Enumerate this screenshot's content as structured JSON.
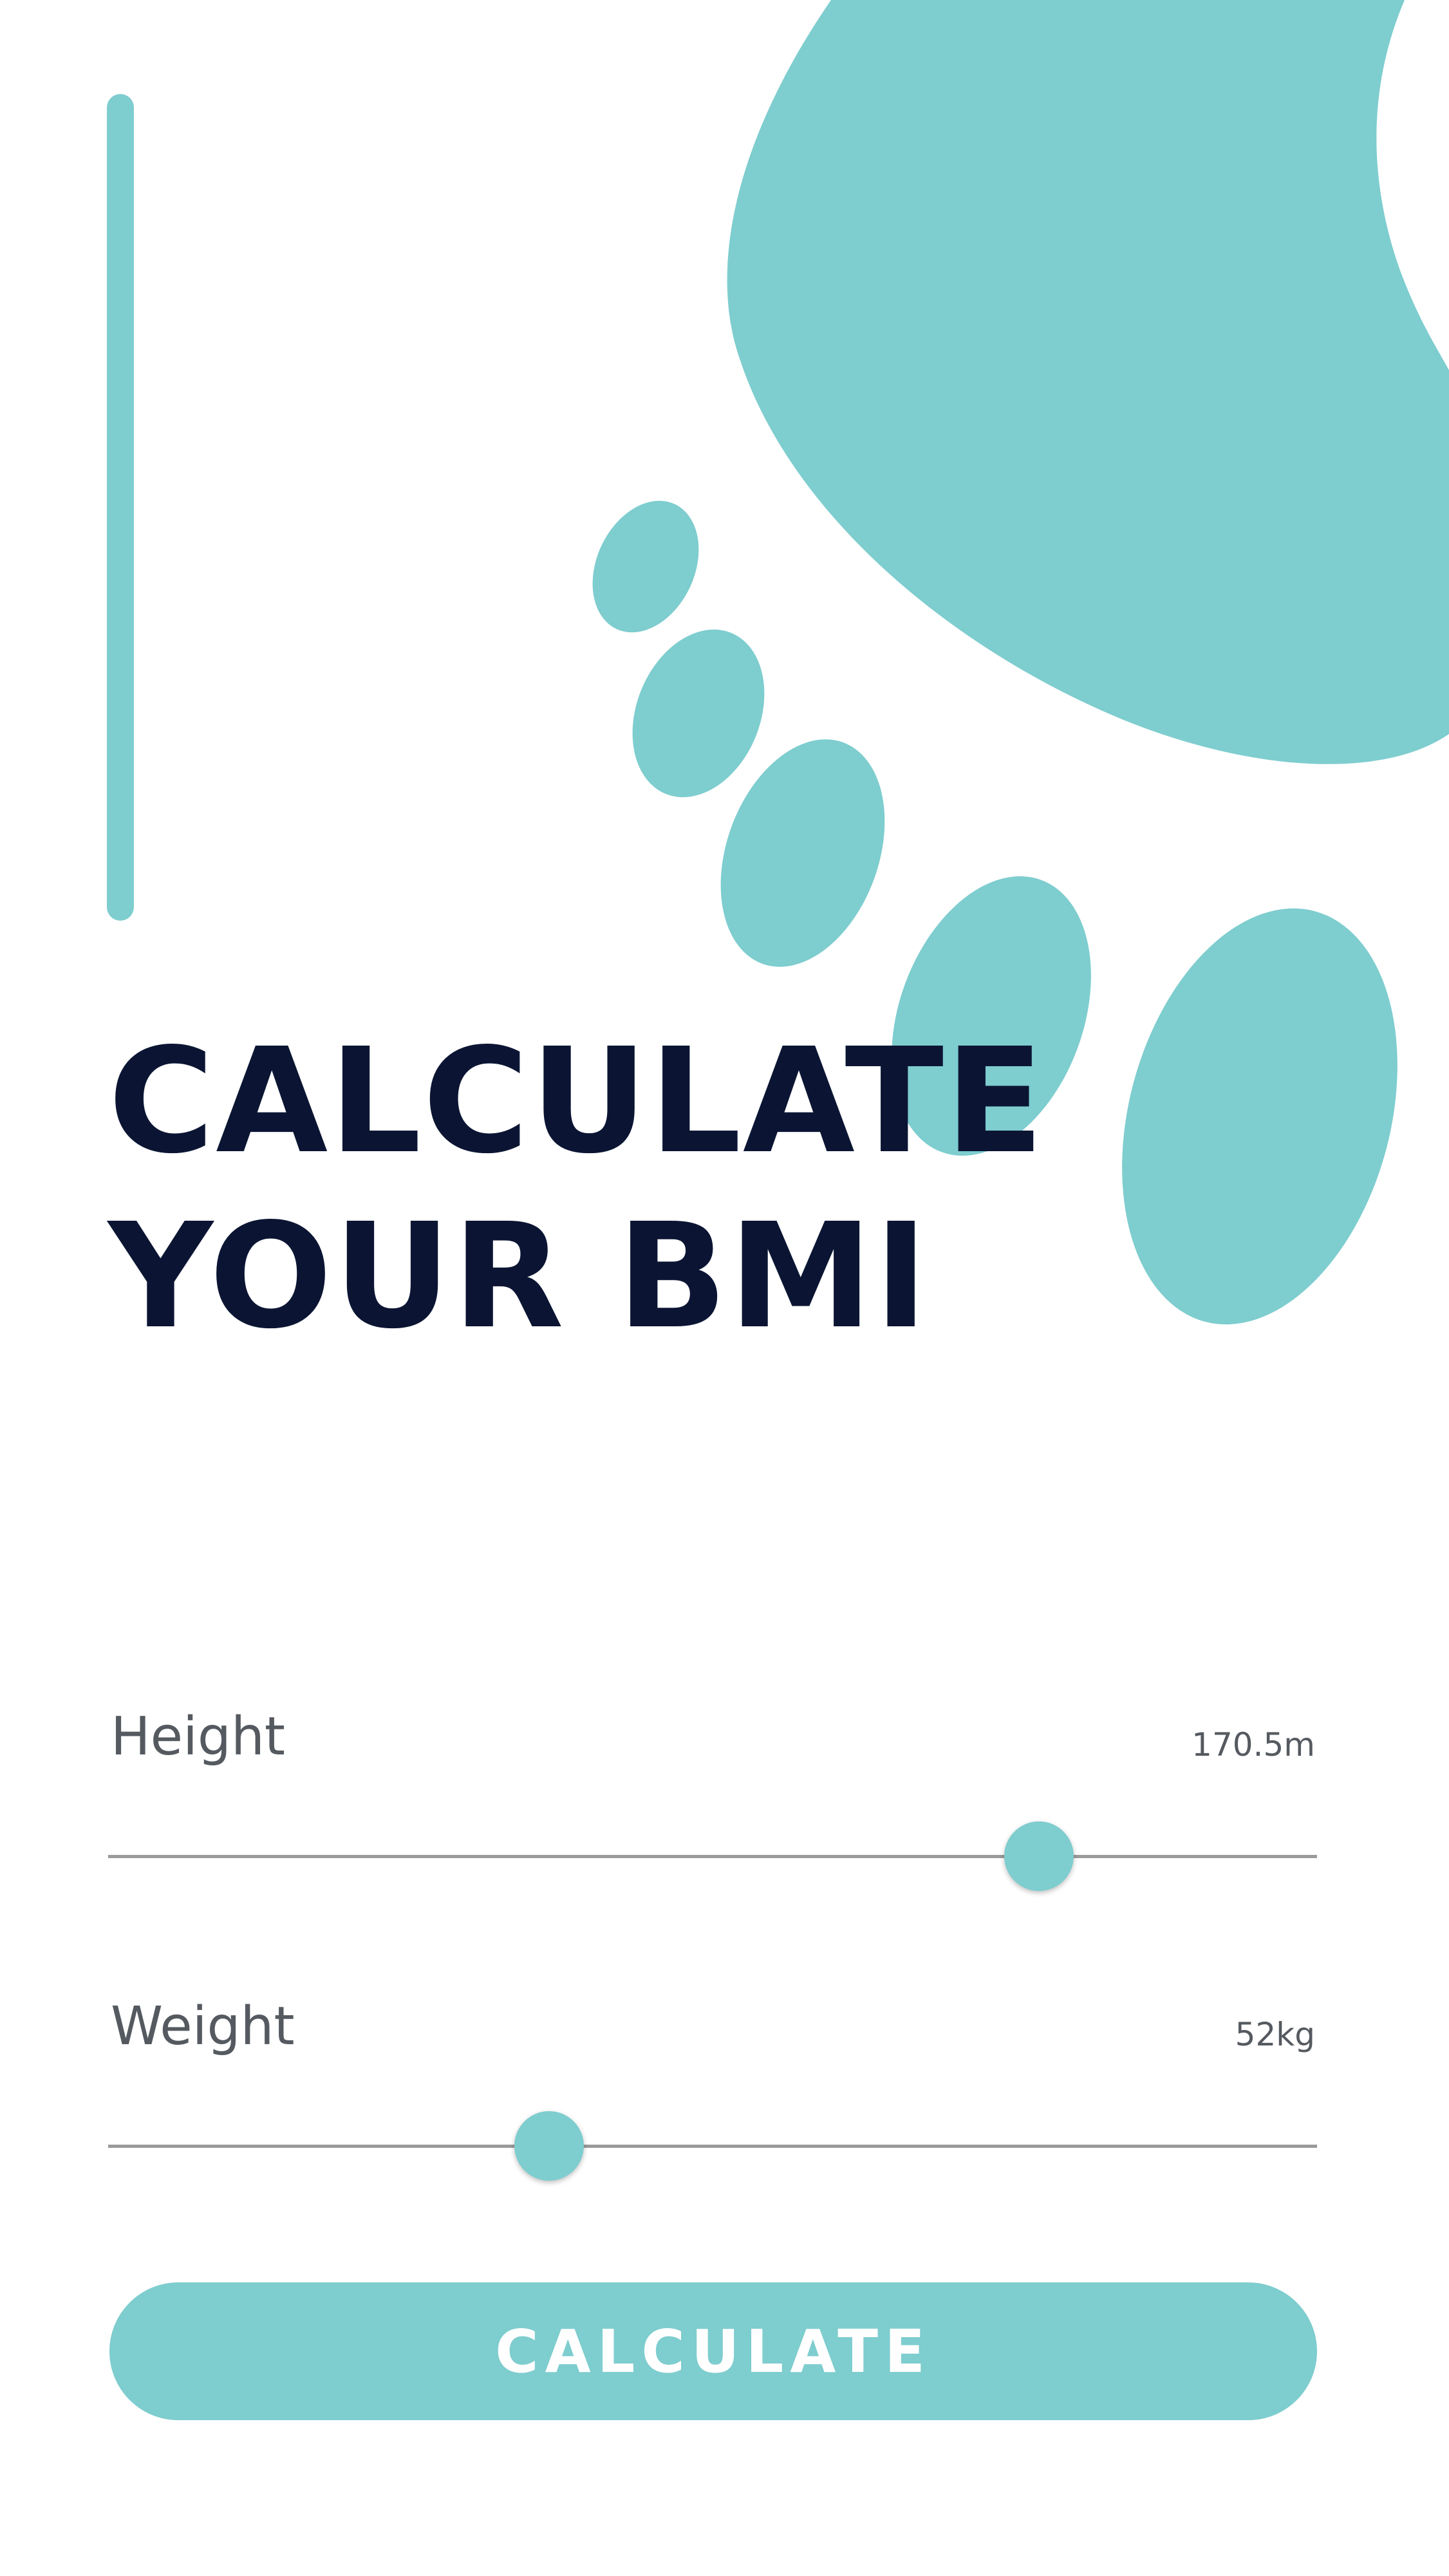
{
  "theme": {
    "accent": "#7ecdcf",
    "title_color": "#0b1533",
    "label_color": "#555a60",
    "track_color": "#9a9a9a",
    "background": "#ffffff"
  },
  "header": {
    "title_line1": "CALCULATE",
    "title_line2": "YOUR BMI"
  },
  "height": {
    "label": "Height",
    "value_text": "170.5m",
    "slider_fraction": 0.77
  },
  "weight": {
    "label": "Weight",
    "value_text": "52kg",
    "slider_fraction": 0.365
  },
  "actions": {
    "calculate_label": "CALCULATE"
  }
}
